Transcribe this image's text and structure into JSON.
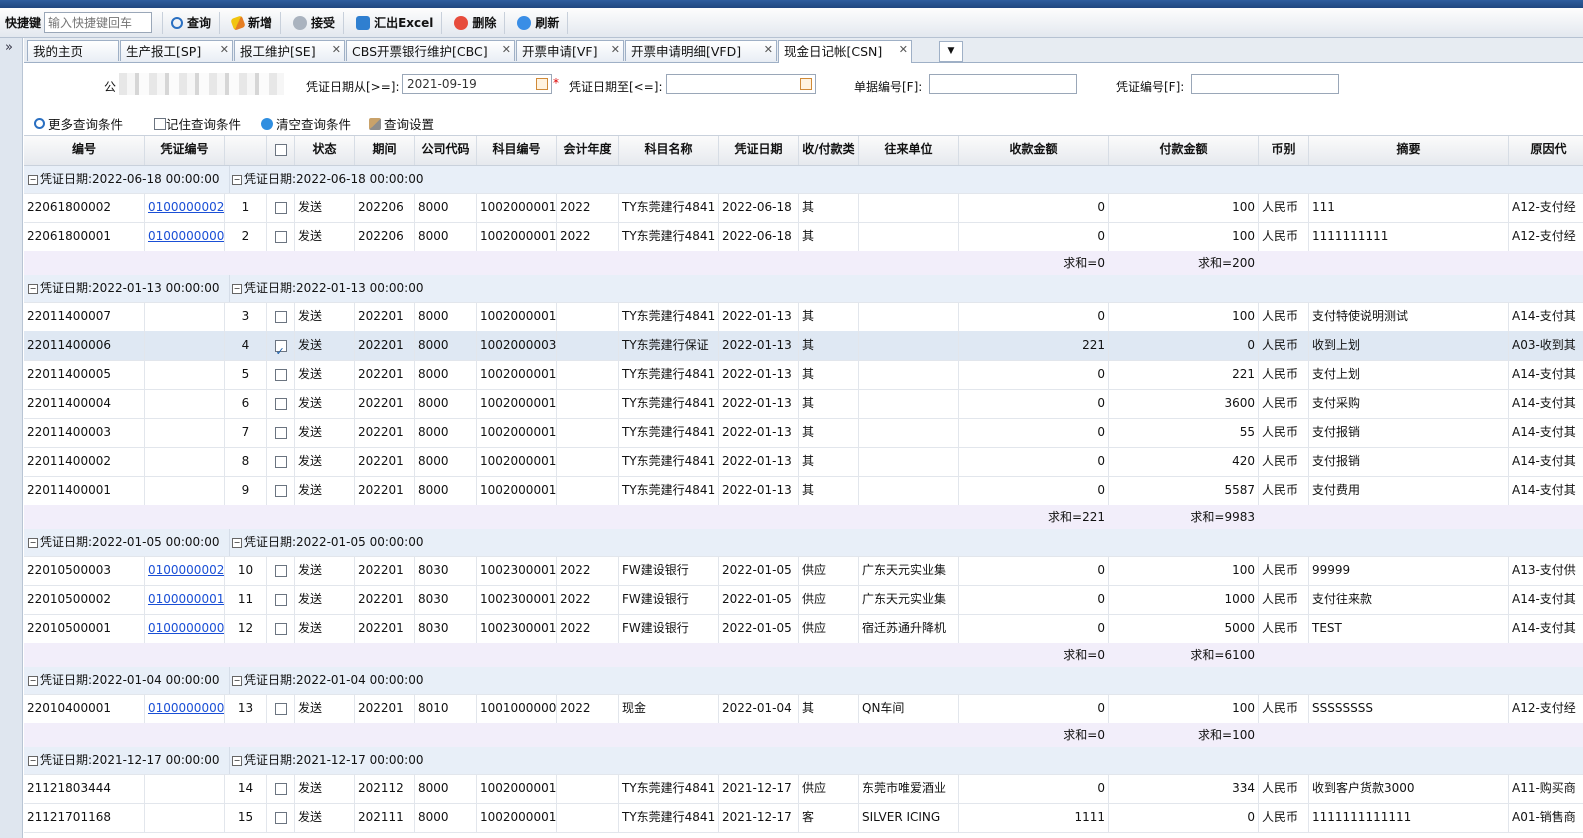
{
  "toolbar": {
    "shortcut_label": "快捷键",
    "shortcut_placeholder": "输入快捷键回车",
    "buttons": [
      {
        "label": "查询",
        "icon": "search-icon"
      },
      {
        "label": "新增",
        "icon": "pencil-add-icon"
      },
      {
        "label": "接受",
        "icon": "gear-accept-icon"
      },
      {
        "label": "汇出Excel",
        "icon": "excel-export-icon"
      },
      {
        "label": "删除",
        "icon": "delete-icon"
      },
      {
        "label": "刷新",
        "icon": "refresh-icon"
      }
    ]
  },
  "gutter": {
    "arrow": "»"
  },
  "tabs": [
    {
      "label": "我的主页"
    },
    {
      "label": "生产报工[SP]"
    },
    {
      "label": "报工维护[SE]"
    },
    {
      "label": "CBS开票银行维护[CBC]"
    },
    {
      "label": "开票申请[VF]"
    },
    {
      "label": "开票申请明细[VFD]"
    },
    {
      "label": "现金日记帐[CSN]"
    }
  ],
  "tab_close": "✕",
  "tab_menu": "▼",
  "query": {
    "company_label_prefix": "公",
    "date_from_label": "凭证日期从[>=]:",
    "date_from_value": "2021-09-19",
    "required_mark": "*",
    "date_to_label": "凭证日期至[<=]:",
    "date_to_value": "",
    "doc_no_label": "单据编号[F]:",
    "doc_no_value": "",
    "voucher_no_label": "凭证编号[F]:",
    "voucher_no_value": "",
    "links": {
      "more": "更多查询条件",
      "remember": "记住查询条件",
      "clear": "清空查询条件",
      "settings": "查询设置"
    }
  },
  "grid": {
    "headers": [
      "编号",
      "凭证编号",
      "",
      "",
      "状态",
      "期间",
      "公司代码",
      "科目编号",
      "会计年度",
      "科目名称",
      "凭证日期",
      "收/付款类",
      "往来单位",
      "收款金额",
      "付款金额",
      "币别",
      "摘要",
      "原因代"
    ],
    "groups": [
      {
        "label": "凭证日期:2022-06-18 00:00:00",
        "rows": [
          {
            "no": "22061800002",
            "voucher": "0100000002",
            "seq": "1",
            "checked": false,
            "status": "发送",
            "period": "202206",
            "company": "8000",
            "account": "1002000001",
            "year": "2022",
            "account_name": "TY东莞建行4841",
            "date": "2022-06-18",
            "type": "其",
            "partner": "",
            "recv": "0",
            "pay": "100",
            "currency": "人民币",
            "summary": "111",
            "reason": "A12-支付经"
          },
          {
            "no": "22061800001",
            "voucher": "0100000000",
            "seq": "2",
            "checked": false,
            "status": "发送",
            "period": "202206",
            "company": "8000",
            "account": "1002000001",
            "year": "2022",
            "account_name": "TY东莞建行4841",
            "date": "2022-06-18",
            "type": "其",
            "partner": "",
            "recv": "0",
            "pay": "100",
            "currency": "人民币",
            "summary": "1111111111",
            "reason": "A12-支付经"
          }
        ],
        "sum_recv": "求和=0",
        "sum_pay": "求和=200"
      },
      {
        "label": "凭证日期:2022-01-13 00:00:00",
        "rows": [
          {
            "no": "22011400007",
            "voucher": "",
            "seq": "3",
            "checked": false,
            "status": "发送",
            "period": "202201",
            "company": "8000",
            "account": "1002000001",
            "year": "",
            "account_name": "TY东莞建行4841",
            "date": "2022-01-13",
            "type": "其",
            "partner": "",
            "recv": "0",
            "pay": "100",
            "currency": "人民币",
            "summary": "支付特使说明测试",
            "reason": "A14-支付其"
          },
          {
            "no": "22011400006",
            "voucher": "",
            "seq": "4",
            "checked": true,
            "status": "发送",
            "period": "202201",
            "company": "8000",
            "account": "1002000003",
            "year": "",
            "account_name": "TY东莞建行保证",
            "date": "2022-01-13",
            "type": "其",
            "partner": "",
            "recv": "221",
            "pay": "0",
            "currency": "人民币",
            "summary": "收到上划",
            "reason": "A03-收到其"
          },
          {
            "no": "22011400005",
            "voucher": "",
            "seq": "5",
            "checked": false,
            "status": "发送",
            "period": "202201",
            "company": "8000",
            "account": "1002000001",
            "year": "",
            "account_name": "TY东莞建行4841",
            "date": "2022-01-13",
            "type": "其",
            "partner": "",
            "recv": "0",
            "pay": "221",
            "currency": "人民币",
            "summary": "支付上划",
            "reason": "A14-支付其"
          },
          {
            "no": "22011400004",
            "voucher": "",
            "seq": "6",
            "checked": false,
            "status": "发送",
            "period": "202201",
            "company": "8000",
            "account": "1002000001",
            "year": "",
            "account_name": "TY东莞建行4841",
            "date": "2022-01-13",
            "type": "其",
            "partner": "",
            "recv": "0",
            "pay": "3600",
            "currency": "人民币",
            "summary": "支付采购",
            "reason": "A14-支付其"
          },
          {
            "no": "22011400003",
            "voucher": "",
            "seq": "7",
            "checked": false,
            "status": "发送",
            "period": "202201",
            "company": "8000",
            "account": "1002000001",
            "year": "",
            "account_name": "TY东莞建行4841",
            "date": "2022-01-13",
            "type": "其",
            "partner": "",
            "recv": "0",
            "pay": "55",
            "currency": "人民币",
            "summary": "支付报销",
            "reason": "A14-支付其"
          },
          {
            "no": "22011400002",
            "voucher": "",
            "seq": "8",
            "checked": false,
            "status": "发送",
            "period": "202201",
            "company": "8000",
            "account": "1002000001",
            "year": "",
            "account_name": "TY东莞建行4841",
            "date": "2022-01-13",
            "type": "其",
            "partner": "",
            "recv": "0",
            "pay": "420",
            "currency": "人民币",
            "summary": "支付报销",
            "reason": "A14-支付其"
          },
          {
            "no": "22011400001",
            "voucher": "",
            "seq": "9",
            "checked": false,
            "status": "发送",
            "period": "202201",
            "company": "8000",
            "account": "1002000001",
            "year": "",
            "account_name": "TY东莞建行4841",
            "date": "2022-01-13",
            "type": "其",
            "partner": "",
            "recv": "0",
            "pay": "5587",
            "currency": "人民币",
            "summary": "支付费用",
            "reason": "A14-支付其"
          }
        ],
        "sum_recv": "求和=221",
        "sum_pay": "求和=9983"
      },
      {
        "label": "凭证日期:2022-01-05 00:00:00",
        "rows": [
          {
            "no": "22010500003",
            "voucher": "0100000002",
            "seq": "10",
            "checked": false,
            "status": "发送",
            "period": "202201",
            "company": "8030",
            "account": "1002300001",
            "year": "2022",
            "account_name": "FW建设银行",
            "date": "2022-01-05",
            "type": "供应",
            "partner": "广东天元实业集",
            "recv": "0",
            "pay": "100",
            "currency": "人民币",
            "summary": "99999",
            "reason": "A13-支付供"
          },
          {
            "no": "22010500002",
            "voucher": "0100000001",
            "seq": "11",
            "checked": false,
            "status": "发送",
            "period": "202201",
            "company": "8030",
            "account": "1002300001",
            "year": "2022",
            "account_name": "FW建设银行",
            "date": "2022-01-05",
            "type": "供应",
            "partner": "广东天元实业集",
            "recv": "0",
            "pay": "1000",
            "currency": "人民币",
            "summary": "支付往来款",
            "reason": "A14-支付其"
          },
          {
            "no": "22010500001",
            "voucher": "0100000000",
            "seq": "12",
            "checked": false,
            "status": "发送",
            "period": "202201",
            "company": "8030",
            "account": "1002300001",
            "year": "2022",
            "account_name": "FW建设银行",
            "date": "2022-01-05",
            "type": "供应",
            "partner": "宿迁苏通升降机",
            "recv": "0",
            "pay": "5000",
            "currency": "人民币",
            "summary": "TEST",
            "reason": "A14-支付其"
          }
        ],
        "sum_recv": "求和=0",
        "sum_pay": "求和=6100"
      },
      {
        "label": "凭证日期:2022-01-04 00:00:00",
        "rows": [
          {
            "no": "22010400001",
            "voucher": "0100000000",
            "seq": "13",
            "checked": false,
            "status": "发送",
            "period": "202201",
            "company": "8010",
            "account": "1001000000",
            "year": "2022",
            "account_name": "现金",
            "date": "2022-01-04",
            "type": "其",
            "partner": "QN车间",
            "recv": "0",
            "pay": "100",
            "currency": "人民币",
            "summary": "SSSSSSSS",
            "reason": "A12-支付经"
          }
        ],
        "sum_recv": "求和=0",
        "sum_pay": "求和=100"
      },
      {
        "label": "凭证日期:2021-12-17 00:00:00",
        "rows": [
          {
            "no": "21121803444",
            "voucher": "",
            "seq": "14",
            "checked": false,
            "status": "发送",
            "period": "202112",
            "company": "8000",
            "account": "1002000001",
            "year": "",
            "account_name": "TY东莞建行4841",
            "date": "2021-12-17",
            "type": "供应",
            "partner": "东莞市唯爱酒业",
            "recv": "0",
            "pay": "334",
            "currency": "人民币",
            "summary": "收到客户货款3000",
            "reason": "A11-购买商"
          },
          {
            "no": "21121701168",
            "voucher": "",
            "seq": "15",
            "checked": false,
            "status": "发送",
            "period": "202111",
            "company": "8000",
            "account": "1002000001",
            "year": "",
            "account_name": "TY东莞建行4841",
            "date": "2021-12-17",
            "type": "客",
            "partner": "SILVER ICING",
            "recv": "1111",
            "pay": "0",
            "currency": "人民币",
            "summary": "1111111111111",
            "reason": "A01-销售商"
          }
        ],
        "sum_recv": "",
        "sum_pay": ""
      }
    ]
  }
}
